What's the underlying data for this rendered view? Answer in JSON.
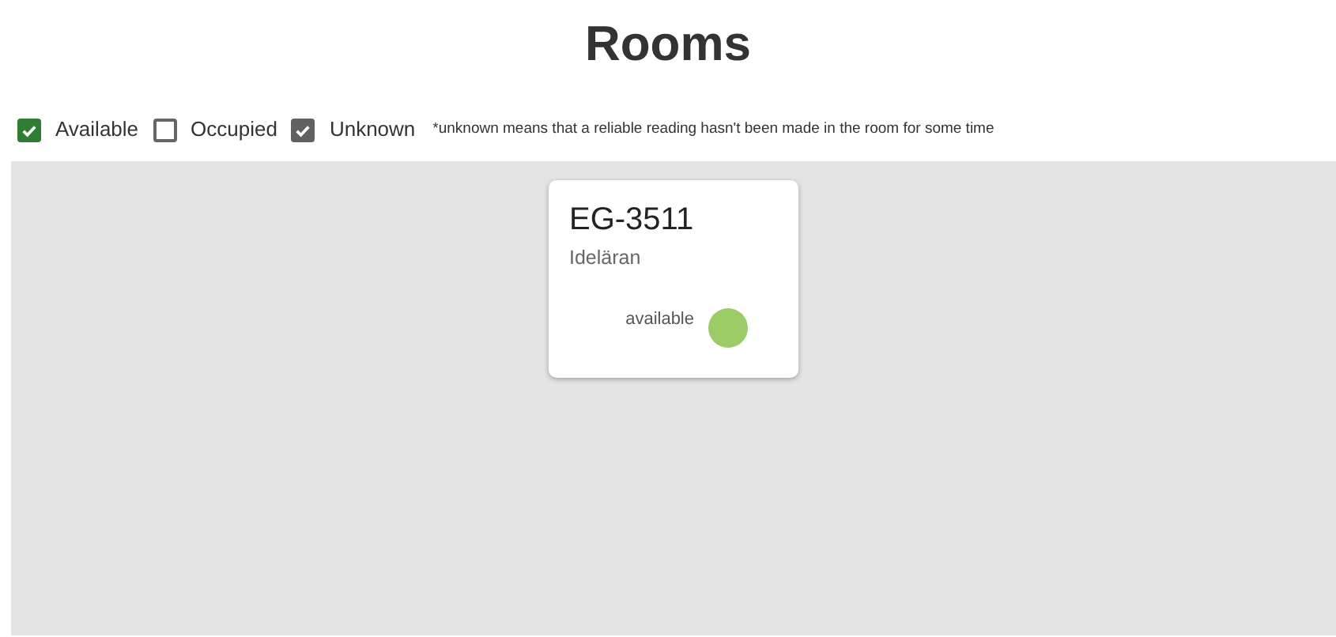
{
  "title": "Rooms",
  "filters": [
    {
      "label": "Available",
      "checked": true,
      "color": "#2e7d32"
    },
    {
      "label": "Occupied",
      "checked": false
    },
    {
      "label": "Unknown",
      "checked": true,
      "color": "#616161"
    }
  ],
  "note": "*unknown means that a reliable reading hasn't been made in the room for some time",
  "rooms": [
    {
      "code": "EG-3511",
      "name": "Ideläran",
      "status": "available",
      "color": "#9ccc65"
    }
  ]
}
